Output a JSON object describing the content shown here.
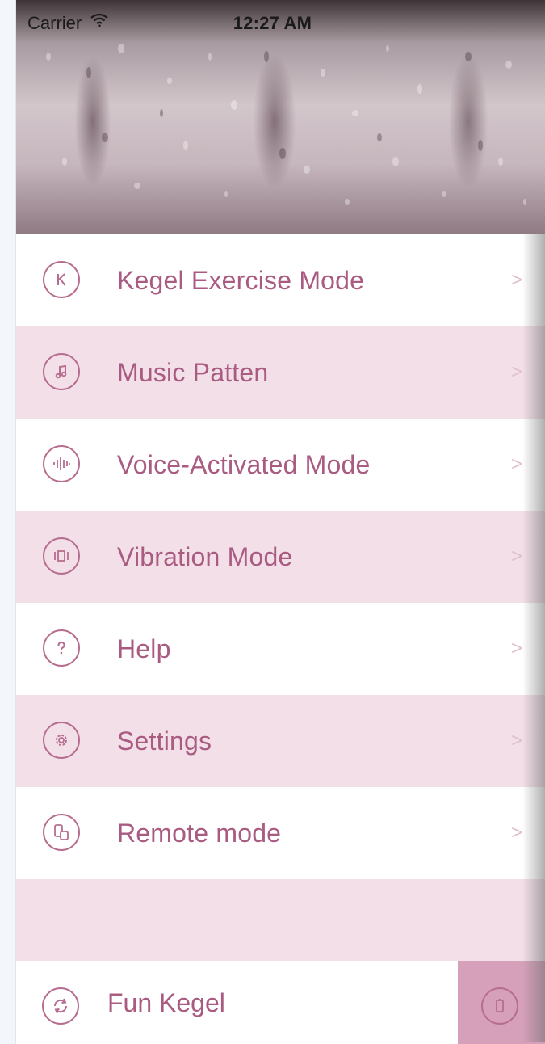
{
  "status_bar": {
    "carrier": "Carrier",
    "time": "12:27 AM"
  },
  "menu": {
    "items": [
      {
        "label": "Kegel Exercise Mode",
        "icon": "kegel-k-icon",
        "chevron": ">"
      },
      {
        "label": "Music Patten",
        "icon": "music-note-icon",
        "chevron": ">"
      },
      {
        "label": "Voice-Activated Mode",
        "icon": "sound-wave-icon",
        "chevron": ">"
      },
      {
        "label": "Vibration Mode",
        "icon": "vibration-icon",
        "chevron": ">"
      },
      {
        "label": "Help",
        "icon": "question-icon",
        "chevron": ">"
      },
      {
        "label": "Settings",
        "icon": "gear-icon",
        "chevron": ">"
      },
      {
        "label": "Remote mode",
        "icon": "remote-devices-icon",
        "chevron": ">"
      }
    ]
  },
  "footer": {
    "label": "Fun Kegel",
    "left_icon": "refresh-icon",
    "right_icon": "device-icon"
  },
  "colors": {
    "accent": "#a95b81",
    "row_pink": "#f3dfe8",
    "footer_pink": "#d6a0ba"
  }
}
